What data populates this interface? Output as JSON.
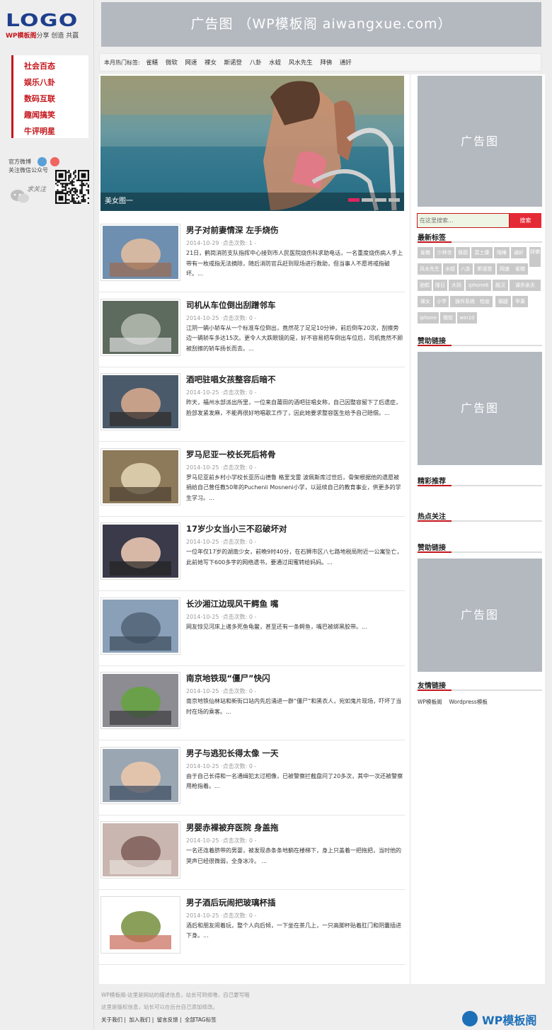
{
  "logo": {
    "word": "LOGO",
    "brand": "WP模板阁",
    "slogan": "分享 创造 共赢"
  },
  "nav": {
    "categories": [
      "社会百态",
      "娱乐八卦",
      "数码互联",
      "趣闻搞笑",
      "牛评明星"
    ]
  },
  "social": {
    "weibo_label": "官方微博",
    "wechat_label": "关注微信公众号",
    "follow_text": "求关注"
  },
  "top_ad": {
    "text": "广告图 （WP模板阁 aiwangxue.com）"
  },
  "hot_tags": {
    "label": "本月热门标签:",
    "tags": [
      "雀鳝",
      "微软",
      "网速",
      "裸女",
      "斯诺登",
      "八卦",
      "水蛭",
      "风水先生",
      "拜佛",
      "通奸"
    ]
  },
  "slider": {
    "caption": "美女图一",
    "active_index": 0,
    "count": 4
  },
  "posts": [
    {
      "title": "男子对前妻情深 左手烧伤",
      "meta": "2014-10-29 ·点击次数: 1 -",
      "excerpt": "21日，鹤岗消防支队指挥中心接到市人民医院烧伤科求助电话，一名重度烧伤病人手上带有一枚戒指无法摘除，随后消防官兵赶到现场进行救助，但当事人不愿将戒指破坏。..."
    },
    {
      "title": "司机从车位倒出刮蹭邻车",
      "meta": "2014-10-25 ·点击次数: 0 -",
      "excerpt": "江阴一辆小轿车从一个标准车位倒出，竟然花了足足10分钟，前后倒车20次，刮擦旁边一辆轿车多达15次。更令人大跌眼镜的是，好不容易把车倒出车位后，司机竟然不顾被刮擦的轿车扬长而去。..."
    },
    {
      "title": "酒吧驻唱女孩整容后暗不",
      "meta": "2014-10-25 ·点击次数: 0 -",
      "excerpt": "昨天，福州水部派出所里，一位来自莆田的酒吧驻唱女称，自己因整容留下了后遗症，脸部发紧发麻，不能再很好地唱歌工作了，因此她要求整容医生给予自己赔偿。..."
    },
    {
      "title": "罗马尼亚一校长死后将骨",
      "meta": "2014-10-25 ·点击次数: 0 -",
      "excerpt": "罗马尼亚前乡村小学校长亚历山德鲁 格里戈雷 波佩斯库过世后，骨架根据他的遗愿被捐给自己曾任教50年的Puchenii Mosneni小学，以延续自己的教育事业，供更多的学生学习。..."
    },
    {
      "title": "17岁少女当小三不忍破坏对",
      "meta": "2014-10-25 ·点击次数: 0 -",
      "excerpt": "一位年仅17岁的湖南少女，前晚9时40分，在石狮市区八七路地税局附近一公寓坠亡，此前她写下600多字的网络遗书，要通过闺蜜转给妈妈。..."
    },
    {
      "title": "长沙湘江边现风干鳄鱼 嘴",
      "meta": "2014-10-25 ·点击次数: 0 -",
      "excerpt": "网友惊见河床上诸多死鱼龟鳖，甚至还有一条鳄鱼，嘴巴被绑黑胶带。..."
    },
    {
      "title": "南京地铁现“僵尸”快闪",
      "meta": "2014-10-25 ·点击次数: 0 -",
      "excerpt": "南京地铁仙林站和新街口站内先后涌进一群“僵尸”和黑衣人，宛如鬼片现场，吓坏了当时在场的乘客。..."
    },
    {
      "title": "男子与逃犯长得太像 一天",
      "meta": "2014-10-25 ·点击次数: 0 -",
      "excerpt": "由于自己长得和一名通缉犯太过相像，已被警察拦截盘问了20多次，其中一次还被警察用枪指着。..."
    },
    {
      "title": "男婴赤裸被弃医院 身盖拖",
      "meta": "2014-10-25 ·点击次数: 0 -",
      "excerpt": "一名还连着脐带的男婴，被发现赤条条地躺在楼梯下，身上只盖着一把拖把，当时他的哭声已经很微弱，全身冰冷。    ..."
    },
    {
      "title": "男子酒后玩闹把玻璃杯插",
      "meta": "2014-10-25 ·点击次数: 0 -",
      "excerpt": "酒后和朋友闹着玩，整个人向后倾，一下坐在茶几上，一只高脚杯贴着肛门和阴囊插进下身。..."
    }
  ],
  "sidebar": {
    "ad_text": "广告图",
    "search_placeholder": "在这里搜索...",
    "search_button": "搜索",
    "latest_tags_title": "最新标签",
    "latest_tags": [
      "雀鳝",
      "少林寺",
      "佩德",
      "富士康",
      "陪睡",
      "通奸",
      "拜佛",
      "风水先生",
      "水蛭",
      "八卦",
      "斯诺登",
      "网速",
      "雀鳝",
      "驰鹤",
      "隆日",
      "大妈",
      "iphone6",
      "殷汉",
      "谋杀亲夫",
      "裸女",
      "小学",
      "操作系统",
      "检疫",
      "瘸腿",
      "苹果",
      "iphone",
      "微软",
      "win10"
    ],
    "sponsor_title_1": "赞助链接",
    "featured_title": "精彩推荐",
    "hot_title": "热点关注",
    "sponsor_title_2": "赞助链接",
    "friends_title": "友情链接",
    "friend_links": [
      "WP模板阁",
      "Wordpress模板"
    ]
  },
  "footer": {
    "line1": "WP模板阁-这里是网站的描述信息，站长可到修噜，自己要写哦",
    "line2": "这里是版权信息，站长可以在后台自己添加修改。",
    "links": [
      "关于我们",
      "加入我们",
      "留言反馈",
      "全部TAG标签"
    ],
    "separator": "|",
    "brand": "WP模板阁"
  },
  "colors": {
    "accent": "#c4161c",
    "ad_gray": "#b4b9c0",
    "search_btn": "#e42a36",
    "dot_active": "#e0245e",
    "footer_brand": "#1d6fb8"
  }
}
